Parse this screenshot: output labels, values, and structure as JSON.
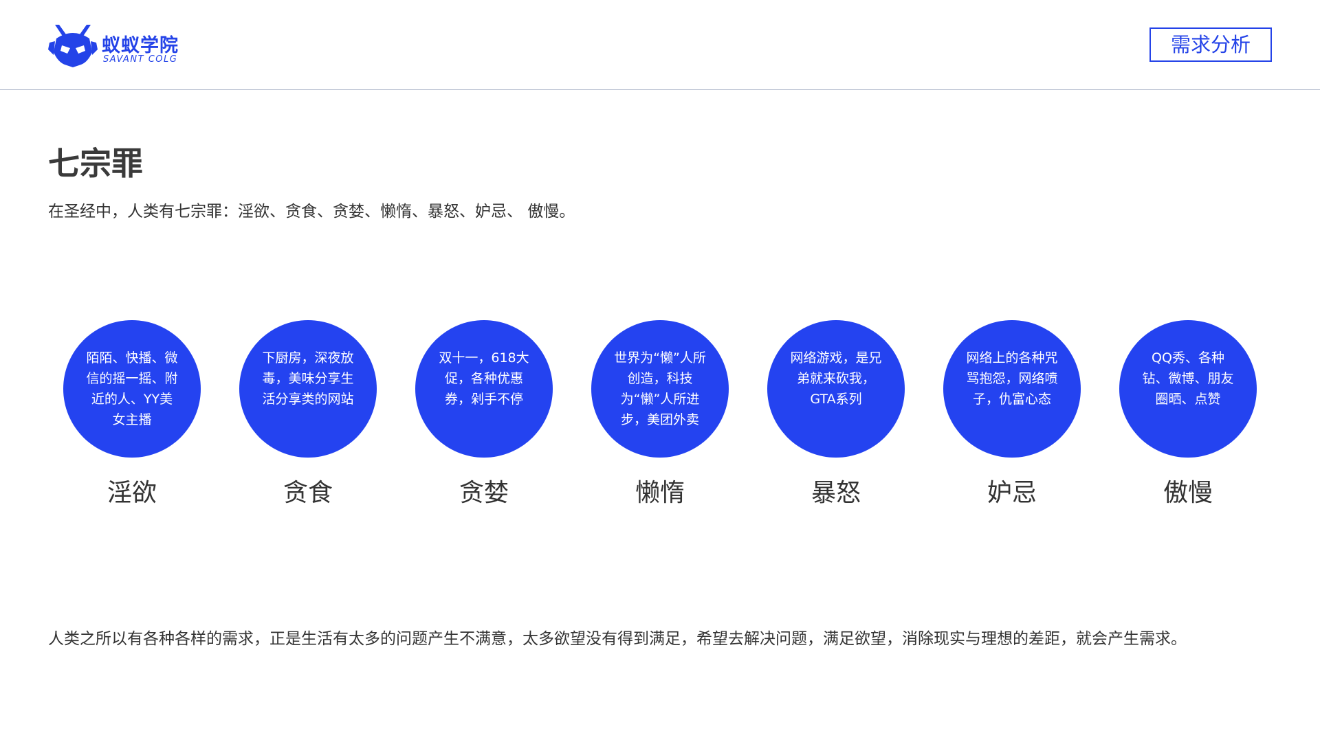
{
  "header": {
    "logo_cn": "蚁蚁学院",
    "logo_en": "SAVANT COLG",
    "tag": "需求分析",
    "brand_color": "#2443e8"
  },
  "main": {
    "title": "七宗罪",
    "intro": "在圣经中，人类有七宗罪：淫欲、贪食、贪婪、懒惰、暴怒、妒忌、 傲慢。",
    "sins": [
      {
        "text": "陌陌、快播、微信的摇一摇、附近的人、YY美女主播",
        "label": "淫欲"
      },
      {
        "text": "下厨房，深夜放毒，美味分享生活分享类的网站",
        "label": "贪食"
      },
      {
        "text": "双十一，618大促，各种优惠券，剁手不停",
        "label": "贪婪"
      },
      {
        "text": "世界为“懒”人所创造，科技为“懒”人所进步，美团外卖",
        "label": "懒惰"
      },
      {
        "text": "网络游戏，是兄弟就来砍我，GTA系列",
        "label": "暴怒"
      },
      {
        "text": "网络上的各种咒骂抱怨，网络喷子，仇富心态",
        "label": "妒忌"
      },
      {
        "text": "QQ秀、各种钻、微博、朋友圈晒、点赞",
        "label": "傲慢"
      }
    ],
    "circle_color": "#2443f0"
  },
  "footer": {
    "text": "人类之所以有各种各样的需求，正是生活有太多的问题产生不满意，太多欲望没有得到满足，希望去解决问题，满足欲望，消除现实与理想的差距，就会产生需求。"
  }
}
